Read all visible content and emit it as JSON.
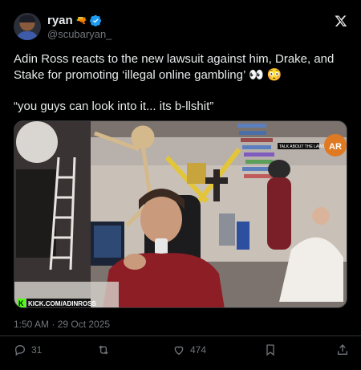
{
  "author": {
    "display_name": "ryan",
    "name_emoji": "🔫",
    "handle": "@scubaryan_"
  },
  "tweet": {
    "text": "Adin Ross reacts to the new lawsuit against him, Drake, and Stake for promoting ‘illegal online gambling’ 👀 😳\n\n“you guys can look into it... its b-llshit”",
    "timestamp": "1:50 AM · 29 Oct 2025"
  },
  "media": {
    "watermark": "KICK.COM/ADINROSS",
    "corner_badge": "AR",
    "overlay_text": "TALK ABOUT THE LAWSUIT"
  },
  "actions": {
    "replies": "31",
    "likes": "474"
  },
  "colors": {
    "background": "#000000",
    "verified": "#1d9bf0",
    "muted": "#71767b",
    "kick_green": "#53fc18"
  }
}
